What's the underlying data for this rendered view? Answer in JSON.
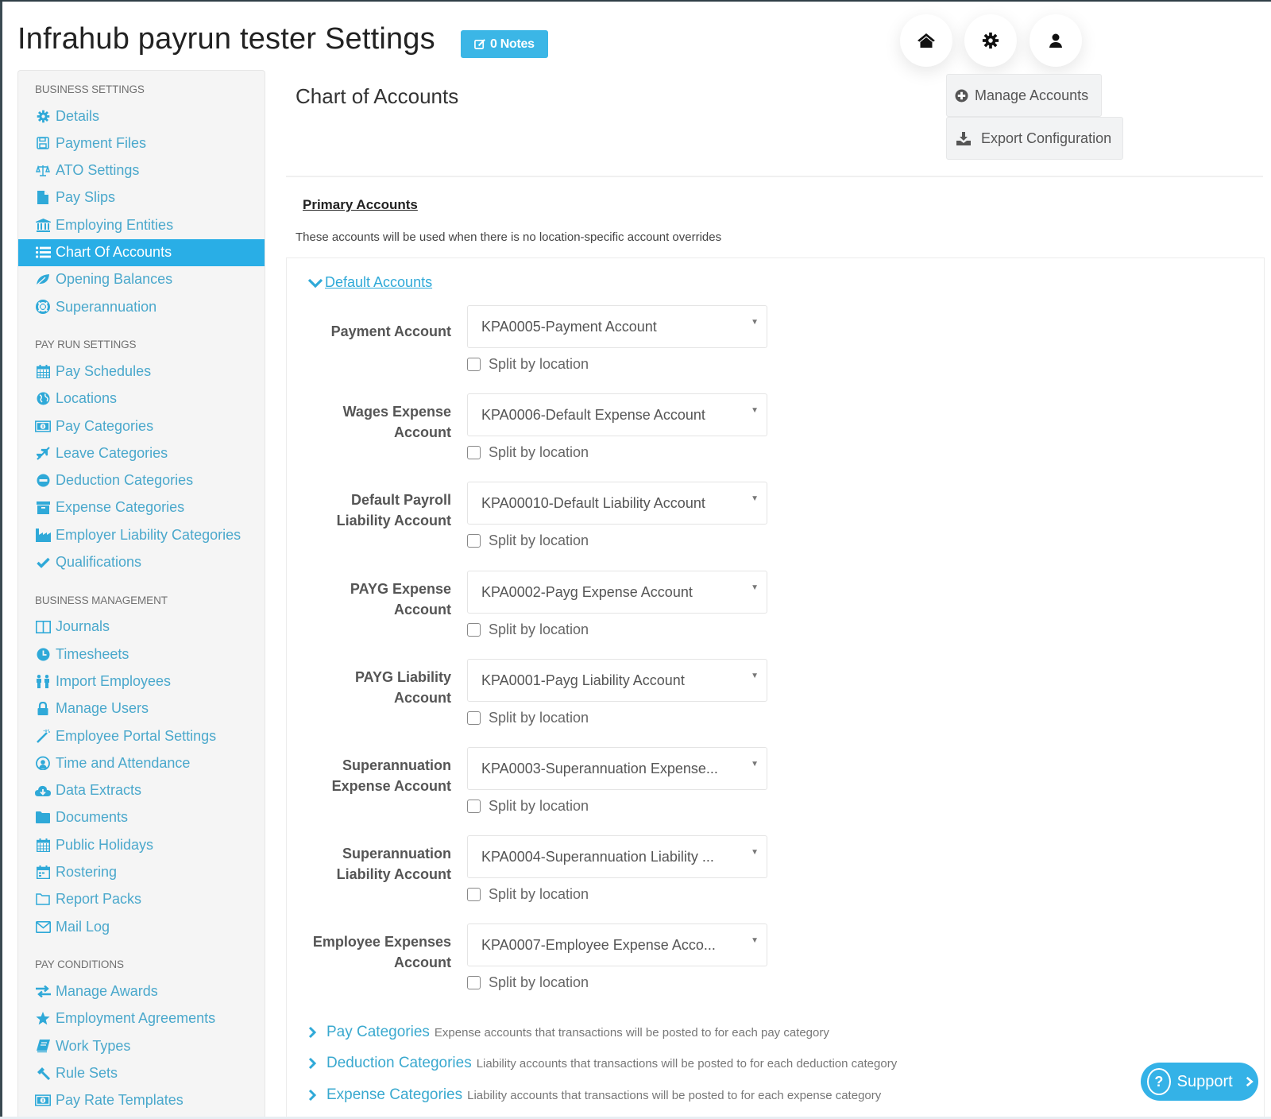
{
  "header": {
    "title": "Infrahub payrun tester Settings",
    "notes_label": "0 Notes",
    "top_buttons": [
      {
        "name": "home",
        "icon": "home-icon"
      },
      {
        "name": "settings",
        "icon": "gear-icon"
      },
      {
        "name": "user",
        "icon": "user-icon"
      }
    ]
  },
  "sidebar": {
    "sections": [
      {
        "heading": "Business Settings",
        "items": [
          {
            "label": "Details",
            "icon": "gear-icon"
          },
          {
            "label": "Payment Files",
            "icon": "floppy-disk-icon"
          },
          {
            "label": "ATO Settings",
            "icon": "scale-icon"
          },
          {
            "label": "Pay Slips",
            "icon": "file-icon"
          },
          {
            "label": "Employing Entities",
            "icon": "bank-icon"
          },
          {
            "label": "Chart Of Accounts",
            "icon": "list-icon",
            "active": true
          },
          {
            "label": "Opening Balances",
            "icon": "leaf-icon"
          },
          {
            "label": "Superannuation",
            "icon": "lifebuoy-icon"
          }
        ]
      },
      {
        "heading": "Pay Run Settings",
        "items": [
          {
            "label": "Pay Schedules",
            "icon": "calendar-icon"
          },
          {
            "label": "Locations",
            "icon": "globe-icon"
          },
          {
            "label": "Pay Categories",
            "icon": "money-icon"
          },
          {
            "label": "Leave Categories",
            "icon": "plane-icon"
          },
          {
            "label": "Deduction Categories",
            "icon": "minus-circle-icon"
          },
          {
            "label": "Expense Categories",
            "icon": "archive-icon"
          },
          {
            "label": "Employer Liability Categories",
            "icon": "industry-icon"
          },
          {
            "label": "Qualifications",
            "icon": "check-icon"
          }
        ]
      },
      {
        "heading": "Business Management",
        "items": [
          {
            "label": "Journals",
            "icon": "columns-icon"
          },
          {
            "label": "Timesheets",
            "icon": "clock-icon"
          },
          {
            "label": "Import Employees",
            "icon": "users-icon"
          },
          {
            "label": "Manage Users",
            "icon": "lock-icon"
          },
          {
            "label": "Employee Portal Settings",
            "icon": "magic-wand-icon"
          },
          {
            "label": "Time and Attendance",
            "icon": "user-clock-icon"
          },
          {
            "label": "Data Extracts",
            "icon": "cloud-download-icon"
          },
          {
            "label": "Documents",
            "icon": "folder-icon"
          },
          {
            "label": "Public Holidays",
            "icon": "calendar-icon"
          },
          {
            "label": "Rostering",
            "icon": "calendar-alt-icon"
          },
          {
            "label": "Report Packs",
            "icon": "folder-open-icon"
          },
          {
            "label": "Mail Log",
            "icon": "envelope-icon"
          }
        ]
      },
      {
        "heading": "Pay Conditions",
        "items": [
          {
            "label": "Manage Awards",
            "icon": "exchange-icon"
          },
          {
            "label": "Employment Agreements",
            "icon": "star-icon"
          },
          {
            "label": "Work Types",
            "icon": "book-icon"
          },
          {
            "label": "Rule Sets",
            "icon": "gavel-icon"
          },
          {
            "label": "Pay Rate Templates",
            "icon": "money-icon"
          }
        ]
      }
    ]
  },
  "main": {
    "title": "Chart of Accounts",
    "manage_accounts_label": "Manage Accounts",
    "export_config_label": "Export Configuration",
    "primary_accounts_label": "Primary Accounts",
    "primary_accounts_desc": "These accounts will be used when there is no location-specific account overrides",
    "default_accounts_label": "Default Accounts",
    "split_label": "Split by location",
    "accounts": [
      {
        "label_lines": [
          "Payment Account"
        ],
        "value": "KPA0005-Payment Account",
        "split": false
      },
      {
        "label_lines": [
          "Wages Expense",
          "Account"
        ],
        "value": "KPA0006-Default Expense Account",
        "split": false
      },
      {
        "label_lines": [
          "Default Payroll",
          "Liability Account"
        ],
        "value": "KPA00010-Default Liability Account",
        "split": false
      },
      {
        "label_lines": [
          "PAYG Expense",
          "Account"
        ],
        "value": "KPA0002-Payg Expense Account",
        "split": false
      },
      {
        "label_lines": [
          "PAYG Liability",
          "Account"
        ],
        "value": "KPA0001-Payg Liability Account",
        "split": false
      },
      {
        "label_lines": [
          "Superannuation",
          "Expense Account"
        ],
        "value": "KPA0003-Superannuation Expense...",
        "split": false
      },
      {
        "label_lines": [
          "Superannuation",
          "Liability Account"
        ],
        "value": "KPA0004-Superannuation Liability ...",
        "split": false
      },
      {
        "label_lines": [
          "Employee Expenses",
          "Account"
        ],
        "value": "KPA0007-Employee Expense Acco...",
        "split": false
      }
    ],
    "category_sections": [
      {
        "label": "Pay Categories",
        "desc": "Expense accounts that transactions will be posted to for each pay category"
      },
      {
        "label": "Deduction Categories",
        "desc": "Liability accounts that transactions will be posted to for each deduction category"
      },
      {
        "label": "Expense Categories",
        "desc": "Liability accounts that transactions will be posted to for each expense category"
      }
    ]
  },
  "support": {
    "label": "Support"
  },
  "colors": {
    "accent": "#29aee6",
    "link": "#2fa9d8",
    "notes_button": "#3bb6e6"
  }
}
